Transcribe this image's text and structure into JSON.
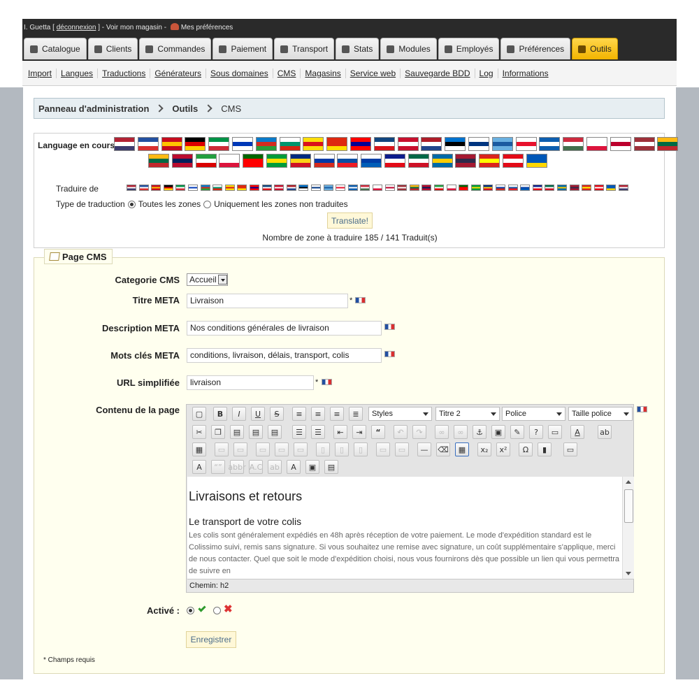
{
  "header": {
    "user": "I. Guetta",
    "logout": "déconnexion",
    "separator": " - ",
    "view_store": "Voir mon magasin",
    "preferences": "Mes préférences"
  },
  "tabs": [
    {
      "label": "Catalogue",
      "icon": "book-icon"
    },
    {
      "label": "Clients",
      "icon": "user-icon"
    },
    {
      "label": "Commandes",
      "icon": "cart-icon"
    },
    {
      "label": "Paiement",
      "icon": "card-icon"
    },
    {
      "label": "Transport",
      "icon": "truck-icon"
    },
    {
      "label": "Stats",
      "icon": "chart-icon"
    },
    {
      "label": "Modules",
      "icon": "puzzle-icon"
    },
    {
      "label": "Employés",
      "icon": "people-icon"
    },
    {
      "label": "Préférences",
      "icon": "sliders-icon"
    },
    {
      "label": "Outils",
      "icon": "tools-icon",
      "active": true
    }
  ],
  "subnav": [
    "Import",
    "Langues",
    "Traductions",
    "Générateurs",
    "Sous domaines",
    "CMS",
    "Magasins",
    "Service web",
    "Sauvegarde BDD",
    "Log",
    "Informations"
  ],
  "breadcrumb": [
    "Panneau d'administration",
    "Outils",
    "CMS"
  ],
  "language": {
    "label": "Language en cours",
    "translate_from_label": "Traduire de",
    "translation_type_label": "Type de traduction",
    "option_all": "Toutes les zones",
    "option_untranslated": "Uniquement les zones non traduites",
    "translate_button": "Translate!",
    "count_text": "Nombre de zone à traduire 185 / 141 Traduit(s)"
  },
  "form": {
    "legend": "Page CMS",
    "category_label": "Categorie CMS",
    "category_value": "Accueil",
    "title_label": "Titre META",
    "title_value": "Livraison",
    "description_label": "Description META",
    "description_value": "Nos conditions générales de livraison",
    "keywords_label": "Mots clés META",
    "keywords_value": "conditions, livraison, délais, transport, colis",
    "url_label": "URL simplifiée",
    "url_value": "livraison",
    "content_label": "Contenu de la page",
    "required_mark": "*",
    "active_label": "Activé :",
    "save_button": "Enregistrer",
    "required_note": "* Champs requis"
  },
  "editor": {
    "styles": "Styles",
    "format": "Titre 2",
    "font": "Police",
    "size": "Taille police",
    "heading": "Livraisons et retours",
    "subheading": "Le transport de votre colis",
    "body": "Les colis sont généralement expédiés en 48h après réception de votre paiement. Le mode d'expédition standard est le Colissimo suivi, remis sans signature. Si vous souhaitez une remise avec signature, un coût supplémentaire s'applique, merci de nous contacter. Quel que soit le mode d'expédition choisi, nous vous fournirons dès que possible un lien qui vous permettra de suivre en",
    "path": "Chemin: h2"
  },
  "colors": {
    "active_tab": "#f2b400",
    "form_background": "#ffffef",
    "breadcrumb_background": "#e7eef2"
  }
}
